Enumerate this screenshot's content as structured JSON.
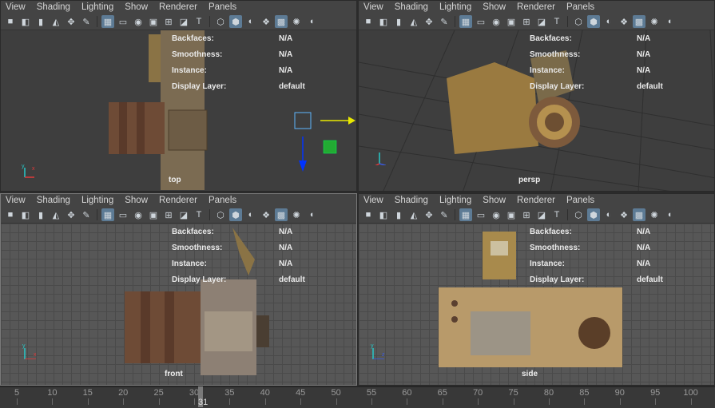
{
  "menu": [
    "View",
    "Shading",
    "Lighting",
    "Show",
    "Renderer",
    "Panels"
  ],
  "toolbar_icons": [
    "camera-icon",
    "camera-attr-icon",
    "bookmark-icon",
    "image-plane-icon",
    "two-d-pan-icon",
    "grease-pencil-icon",
    "grid-icon",
    "film-gate-icon",
    "resolution-gate-icon",
    "gate-mask-icon",
    "field-chart-icon",
    "safe-action-icon",
    "safe-title-icon",
    "wireframe-icon",
    "smooth-shade-icon",
    "use-default-material-icon",
    "wireframe-on-shaded-icon",
    "textured-icon",
    "use-all-lights-icon",
    "shadows-icon"
  ],
  "hud": {
    "labels": [
      "Backfaces:",
      "Smoothness:",
      "Instance:",
      "Display Layer:"
    ],
    "values": [
      "N/A",
      "N/A",
      "N/A",
      "default"
    ]
  },
  "viewports": {
    "top": {
      "camera": "top"
    },
    "persp": {
      "camera": "persp"
    },
    "front": {
      "camera": "front"
    },
    "side": {
      "camera": "side"
    }
  },
  "timeline": {
    "ticks": [
      "5",
      "10",
      "15",
      "20",
      "25",
      "30",
      "35",
      "40",
      "45",
      "50",
      "55",
      "60",
      "65",
      "70",
      "75",
      "80",
      "85",
      "90",
      "95",
      "100"
    ],
    "current_frame": "31"
  }
}
